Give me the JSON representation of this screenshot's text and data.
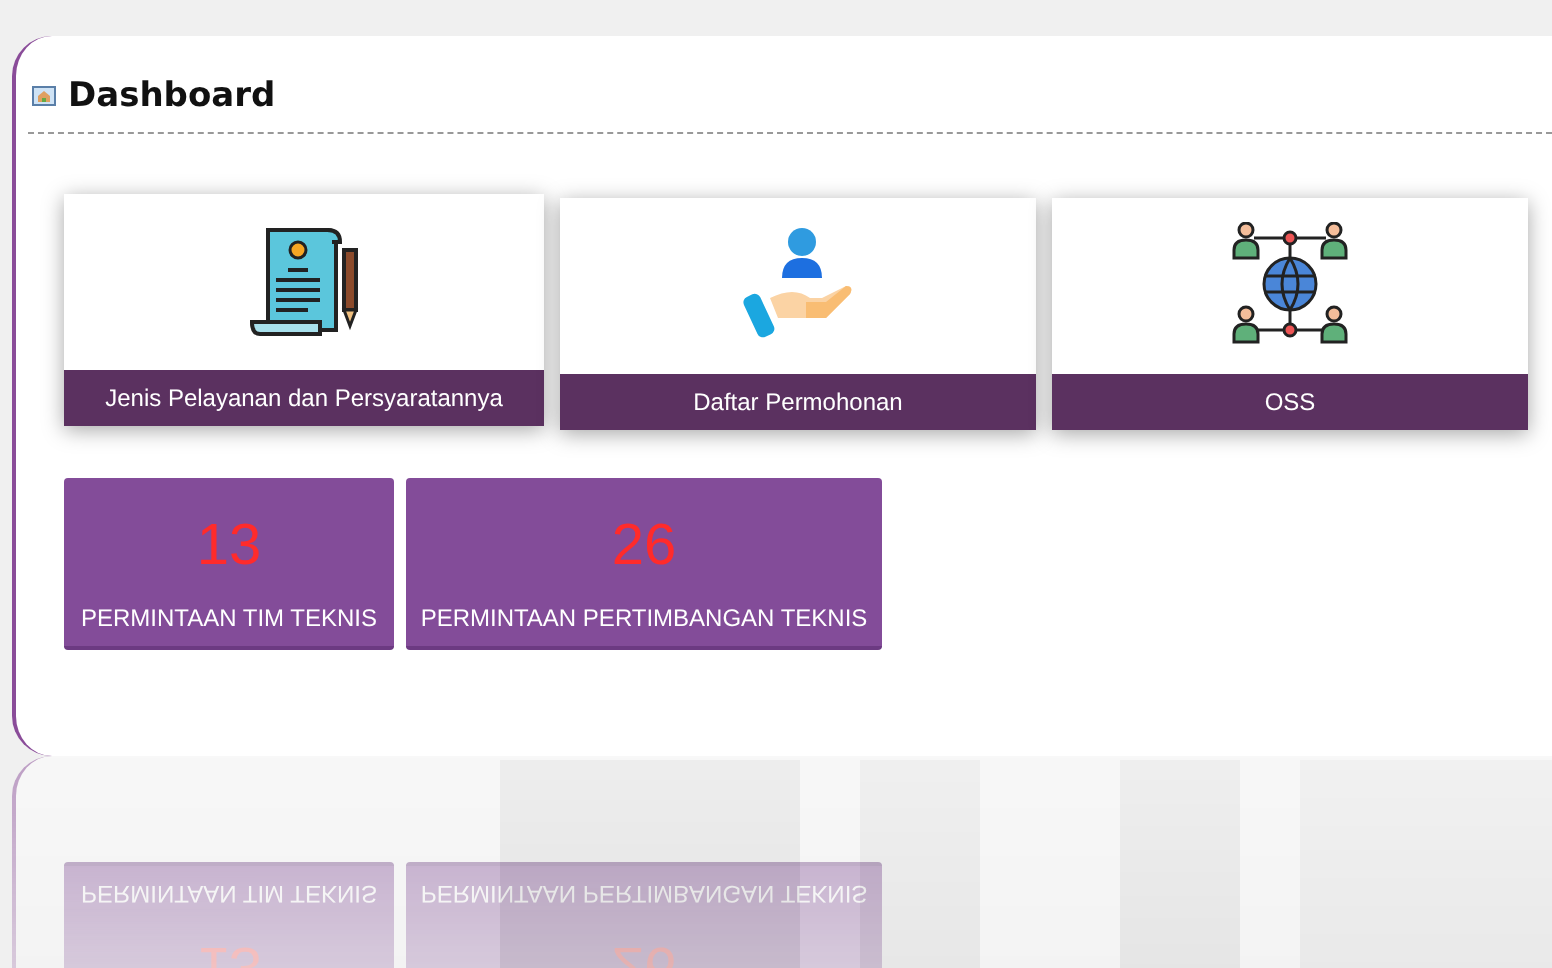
{
  "page": {
    "title": "Dashboard"
  },
  "menu_cards": [
    {
      "label": "Jenis Pelayanan dan Persyaratannya"
    },
    {
      "label": "Daftar Permohonan"
    },
    {
      "label": "OSS"
    }
  ],
  "stat_cards": [
    {
      "value": "13",
      "label": "PERMINTAAN TIM TEKNIS"
    },
    {
      "value": "26",
      "label": "PERMINTAAN PERTIMBANGAN TEKNIS"
    }
  ]
}
